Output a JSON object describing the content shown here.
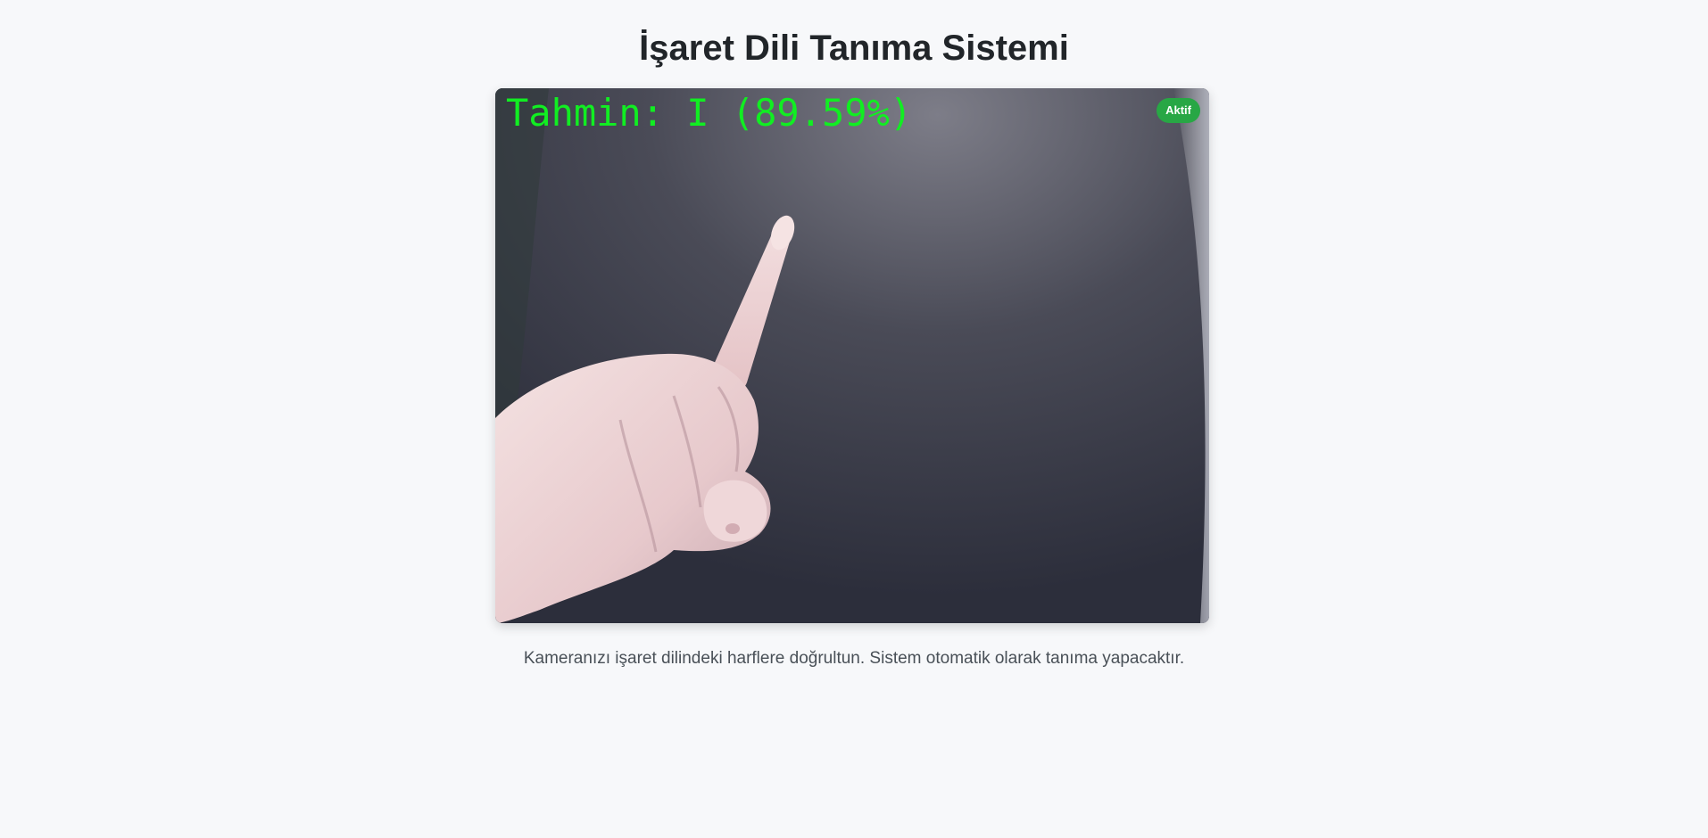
{
  "header": {
    "title": "İşaret Dili Tanıma Sistemi"
  },
  "camera": {
    "prediction_text": "Tahmin: I (89.59%)",
    "status_badge": "Aktif",
    "status_color": "#28a745",
    "overlay_text_color": "#11ee22"
  },
  "footer": {
    "instructions": "Kameranızı işaret dilindeki harflere doğrultun. Sistem otomatik olarak tanıma yapacaktır."
  }
}
